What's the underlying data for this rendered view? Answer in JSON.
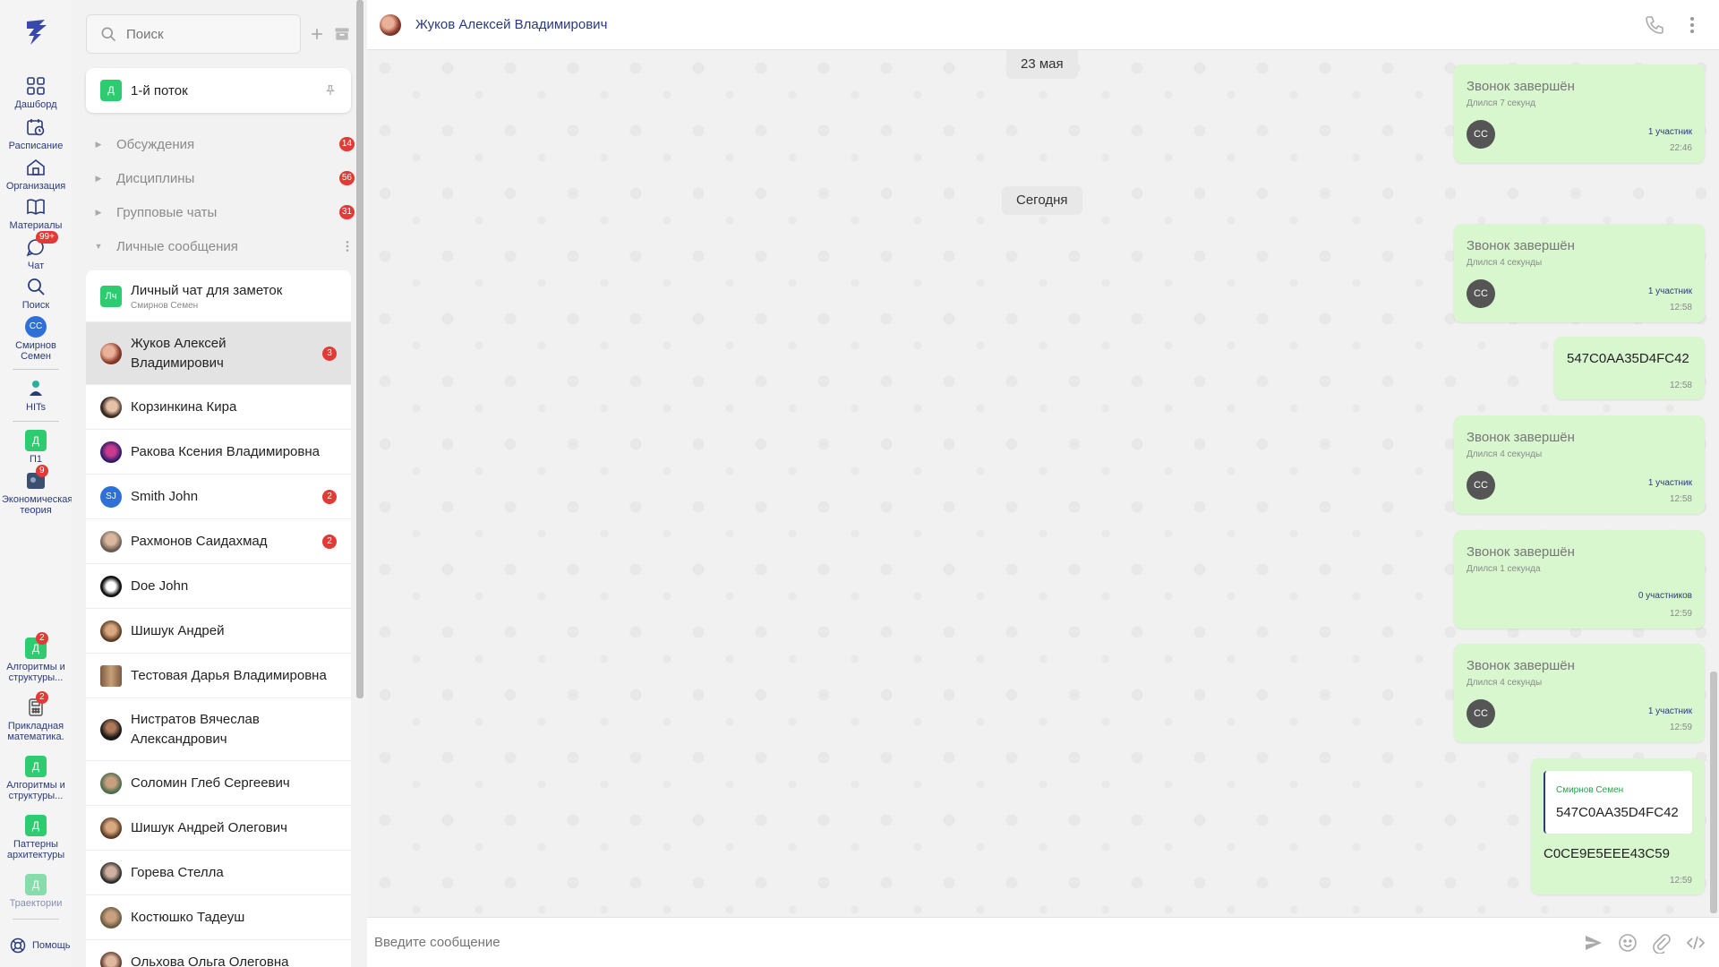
{
  "nav": {
    "items": [
      {
        "label": "Дашборд"
      },
      {
        "label": "Расписание"
      },
      {
        "label": "Организация"
      },
      {
        "label": "Материалы"
      },
      {
        "label": "Чат",
        "badge": "99+"
      },
      {
        "label": "Поиск"
      },
      {
        "label": "Смирнов Семен",
        "initials": "СС"
      },
      {
        "label": "HITs"
      }
    ],
    "groups": [
      {
        "label": "П1",
        "initial": "Д",
        "badge": ""
      },
      {
        "label": "Экономическая теория",
        "initial": "",
        "badge": "9"
      },
      {
        "label": "Алгоритмы и структуры...",
        "initial": "Д",
        "badge": "2"
      },
      {
        "label": "Прикладная математика.",
        "initial": "",
        "badge": "2"
      },
      {
        "label": "Алгоритмы и структуры...",
        "initial": "Д",
        "badge": ""
      },
      {
        "label": "Паттерны архитектуры",
        "initial": "Д",
        "badge": ""
      },
      {
        "label": "Траектории",
        "initial": "Д",
        "badge": ""
      }
    ],
    "help_label": "Помощь"
  },
  "panel": {
    "search_placeholder": "Поиск",
    "stream": {
      "initial": "Д",
      "title": "1-й поток"
    },
    "sections": [
      {
        "label": "Обсуждения",
        "count": "14"
      },
      {
        "label": "Дисциплины",
        "count": "56"
      },
      {
        "label": "Групповые чаты",
        "count": "31"
      },
      {
        "label": "Личные сообщения",
        "count": ""
      }
    ],
    "chats": [
      {
        "name": "Личный чат для заметок",
        "sub": "Смирнов Семен",
        "initials": "Лч",
        "count": ""
      },
      {
        "name": "Жуков Алексей Владимирович",
        "sub": "",
        "initials": "",
        "count": "3"
      },
      {
        "name": "Корзинкина Кира",
        "sub": "",
        "initials": "",
        "count": ""
      },
      {
        "name": "Ракова Ксения Владимировна",
        "sub": "",
        "initials": "",
        "count": ""
      },
      {
        "name": "Smith John",
        "sub": "",
        "initials": "SJ",
        "count": "2"
      },
      {
        "name": "Рахмонов Саидахмад",
        "sub": "",
        "initials": "",
        "count": "2"
      },
      {
        "name": "Doe John",
        "sub": "",
        "initials": "",
        "count": ""
      },
      {
        "name": "Шишук Андрей",
        "sub": "",
        "initials": "",
        "count": ""
      },
      {
        "name": "Тестовая Дарья Владимировна",
        "sub": "",
        "initials": "",
        "count": ""
      },
      {
        "name": "Нистратов Вячеслав Александрович",
        "sub": "",
        "initials": "",
        "count": ""
      },
      {
        "name": "Соломин Глеб Сергеевич",
        "sub": "",
        "initials": "",
        "count": ""
      },
      {
        "name": "Шишук Андрей Олегович",
        "sub": "",
        "initials": "",
        "count": ""
      },
      {
        "name": "Горева Стелла",
        "sub": "",
        "initials": "",
        "count": ""
      },
      {
        "name": "Костюшко Тадеуш",
        "sub": "",
        "initials": "",
        "count": ""
      },
      {
        "name": "Ольхова Ольга Олеговна",
        "sub": "",
        "initials": "",
        "count": ""
      }
    ]
  },
  "chat": {
    "title": "Жуков Алексей Владимирович",
    "dates": [
      "23 мая",
      "Сегодня"
    ],
    "messages": [
      {
        "type": "call",
        "title": "Звонок завершён",
        "duration": "Длился 7 секунд",
        "initials": "СС",
        "participants": "1 участник",
        "time": "22:46"
      },
      {
        "type": "call",
        "title": "Звонок завершён",
        "duration": "Длился 4 секунды",
        "initials": "СС",
        "participants": "1 участник",
        "time": "12:58"
      },
      {
        "type": "text",
        "text": "547C0AA35D4FC42",
        "time": "12:58"
      },
      {
        "type": "call",
        "title": "Звонок завершён",
        "duration": "Длился 4 секунды",
        "initials": "СС",
        "participants": "1 участник",
        "time": "12:58"
      },
      {
        "type": "call",
        "title": "Звонок завершён",
        "duration": "Длился 1 секунда",
        "initials": "",
        "participants": "0 участников",
        "time": "12:59"
      },
      {
        "type": "call",
        "title": "Звонок завершён",
        "duration": "Длился 4 секунды",
        "initials": "СС",
        "participants": "1 участник",
        "time": "12:59"
      },
      {
        "type": "reply",
        "quote_author": "Смирнов Семен",
        "quote_text": "547C0AA35D4FC42",
        "text": "C0CE9E5EEE43C59",
        "time": "12:59"
      }
    ],
    "composer_placeholder": "Введите сообщение"
  },
  "colors": {
    "accent": "#2a3a7a",
    "badge": "#e53935",
    "bubble": "#d8f7cf",
    "group_square": "#2ecc71"
  }
}
